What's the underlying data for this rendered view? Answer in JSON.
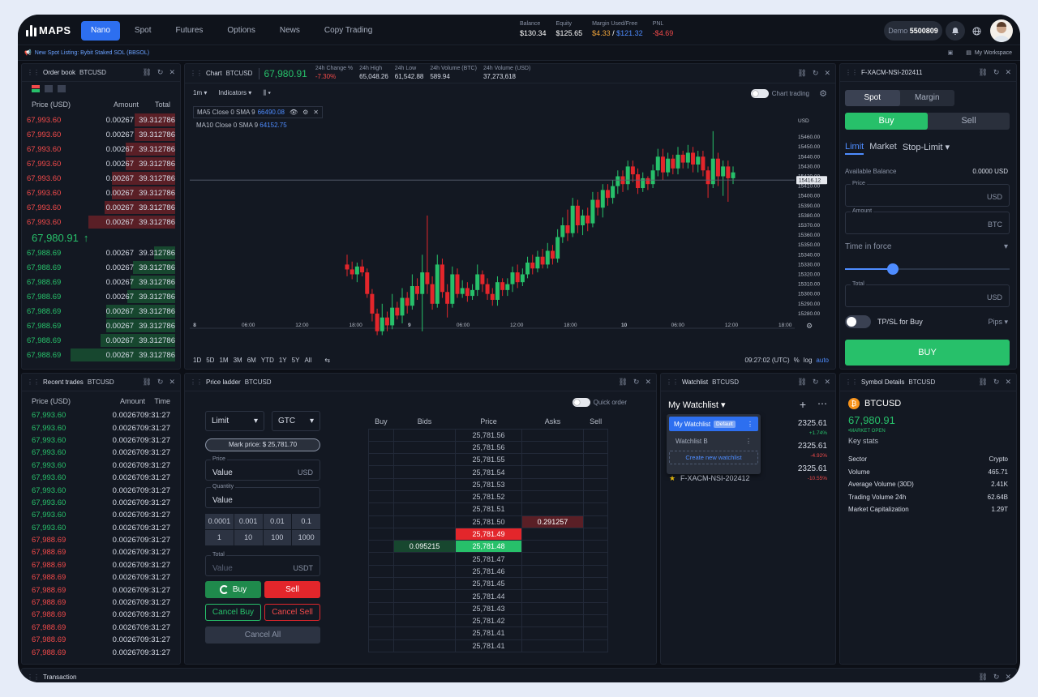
{
  "app": {
    "logo": "MAPS"
  },
  "nav": [
    "Nano",
    "Spot",
    "Futures",
    "Options",
    "News",
    "Copy Trading"
  ],
  "account": {
    "balance_label": "Balance",
    "balance": "$130.34",
    "equity_label": "Equity",
    "equity": "$125.65",
    "margin_label": "Margin Used/Free",
    "margin_used": "$4.33",
    "margin_sep": " / ",
    "margin_free": "$121.32",
    "pnl_label": "PNL",
    "pnl": "-$4.69",
    "demo_label": "Demo",
    "demo_id": "5500809"
  },
  "announcement": "New Spot Listing: Bybit Staked SOL (BBSOL)",
  "workspace": "My Workspace",
  "orderbook": {
    "title": "Order book",
    "symbol": "BTCUSD",
    "headers": [
      "Price (USD)",
      "Amount",
      "Total"
    ],
    "asks": [
      {
        "p": "67,993.60",
        "a": "0.00267",
        "t": "39.312786",
        "d": 0.27
      },
      {
        "p": "67,993.60",
        "a": "0.00267",
        "t": "39.312786",
        "d": 0.27
      },
      {
        "p": "67,993.60",
        "a": "0.00267",
        "t": "39.312786",
        "d": 0.33
      },
      {
        "p": "67,993.60",
        "a": "0.00267",
        "t": "39.312786",
        "d": 0.33
      },
      {
        "p": "67,993.60",
        "a": "0.00267",
        "t": "39.312786",
        "d": 0.42
      },
      {
        "p": "67,993.60",
        "a": "0.00267",
        "t": "39.312786",
        "d": 0.42
      },
      {
        "p": "67,993.60",
        "a": "0.00267",
        "t": "39.312786",
        "d": 0.47
      },
      {
        "p": "67,993.60",
        "a": "0.00267",
        "t": "39.312786",
        "d": 0.58
      }
    ],
    "last": "67,980.91",
    "bids": [
      {
        "p": "67,988.69",
        "a": "0.00267",
        "t": "39.312786",
        "d": 0.14
      },
      {
        "p": "67,988.69",
        "a": "0.00267",
        "t": "39.312786",
        "d": 0.28
      },
      {
        "p": "67,988.69",
        "a": "0.00267",
        "t": "39.312786",
        "d": 0.3
      },
      {
        "p": "67,988.69",
        "a": "0.00267",
        "t": "39.312786",
        "d": 0.32
      },
      {
        "p": "67,988.69",
        "a": "0.00267",
        "t": "39.312786",
        "d": 0.46
      },
      {
        "p": "67,988.69",
        "a": "0.00267",
        "t": "39.312786",
        "d": 0.46
      },
      {
        "p": "67,988.69",
        "a": "0.00267",
        "t": "39.312786",
        "d": 0.5
      },
      {
        "p": "67,988.69",
        "a": "0.00267",
        "t": "39.312786",
        "d": 0.7
      }
    ]
  },
  "chart": {
    "title": "Chart",
    "symbol": "BTCUSD",
    "price": "67,980.91",
    "change_label": "24h Change %",
    "change": "-7.30%",
    "high_label": "24h High",
    "high": "65,048.26",
    "low_label": "24h Low",
    "low": "61,542.88",
    "vol_btc_label": "24h Volume (BTC)",
    "vol_btc": "589.94",
    "vol_usd_label": "24h Volume (USD)",
    "vol_usd": "37,273,618",
    "interval": "1m",
    "indicators": "Indicators",
    "chart_trading": "Chart trading",
    "ma5_label": "MA5 Close 0 SMA 9",
    "ma5_value": "66490.08",
    "ma10_label": "MA10 Close 0 SMA 9",
    "ma10_value": "64152.75",
    "currency": "USD",
    "price_ticks": [
      "15460.00",
      "15450.00",
      "15440.00",
      "15430.00",
      "15420.00",
      "15410.00",
      "15400.00",
      "15390.00",
      "15380.00",
      "15370.00",
      "15360.00",
      "15350.00",
      "15340.00",
      "15330.00",
      "15320.00",
      "15310.00",
      "15300.00",
      "15290.00",
      "15280.00"
    ],
    "current_marker": "15416.12",
    "time_ticks": [
      "8",
      "06:00",
      "12:00",
      "18:00",
      "9",
      "06:00",
      "12:00",
      "18:00",
      "10",
      "06:00",
      "12:00",
      "18:00"
    ],
    "timeframes": [
      "1D",
      "5D",
      "1M",
      "3M",
      "6M",
      "YTD",
      "1Y",
      "5Y",
      "All"
    ],
    "clock": "09:27:02 (UTC)",
    "pct": "%",
    "log": "log",
    "auto": "auto"
  },
  "chart_data": {
    "type": "candlestick",
    "y_range": [
      15270,
      15470
    ],
    "candles": [
      [
        15330,
        15325,
        15340,
        15318
      ],
      [
        15325,
        15320,
        15333,
        15315
      ],
      [
        15320,
        15328,
        15332,
        15312
      ],
      [
        15328,
        15322,
        15335,
        15318
      ],
      [
        15322,
        15300,
        15326,
        15296
      ],
      [
        15300,
        15280,
        15305,
        15272
      ],
      [
        15280,
        15262,
        15285,
        15258
      ],
      [
        15262,
        15276,
        15290,
        15258
      ],
      [
        15276,
        15268,
        15282,
        15262
      ],
      [
        15268,
        15286,
        15300,
        15264
      ],
      [
        15286,
        15278,
        15292,
        15274
      ],
      [
        15278,
        15296,
        15306,
        15270
      ],
      [
        15296,
        15288,
        15302,
        15280
      ],
      [
        15288,
        15308,
        15320,
        15284
      ],
      [
        15308,
        15300,
        15316,
        15294
      ],
      [
        15300,
        15322,
        15340,
        15262
      ],
      [
        15322,
        15310,
        15380,
        15300
      ],
      [
        15310,
        15290,
        15318,
        15284
      ],
      [
        15290,
        15330,
        15340,
        15286
      ],
      [
        15330,
        15302,
        15336,
        15296
      ],
      [
        15302,
        15290,
        15310,
        15276
      ],
      [
        15290,
        15320,
        15328,
        15286
      ],
      [
        15320,
        15300,
        15326,
        15296
      ],
      [
        15300,
        15306,
        15314,
        15296
      ],
      [
        15306,
        15298,
        15312,
        15292
      ],
      [
        15298,
        15304,
        15310,
        15294
      ],
      [
        15304,
        15320,
        15330,
        15298
      ],
      [
        15320,
        15310,
        15324,
        15302
      ],
      [
        15310,
        15300,
        15316,
        15294
      ],
      [
        15300,
        15294,
        15306,
        15288
      ],
      [
        15294,
        15312,
        15318,
        15288
      ],
      [
        15312,
        15304,
        15316,
        15298
      ],
      [
        15304,
        15310,
        15316,
        15298
      ],
      [
        15310,
        15322,
        15328,
        15302
      ],
      [
        15322,
        15312,
        15330,
        15306
      ],
      [
        15312,
        15320,
        15326,
        15308
      ],
      [
        15320,
        15332,
        15338,
        15316
      ],
      [
        15332,
        15326,
        15340,
        15320
      ],
      [
        15326,
        15338,
        15344,
        15322
      ],
      [
        15338,
        15330,
        15346,
        15326
      ],
      [
        15330,
        15344,
        15352,
        15326
      ],
      [
        15344,
        15336,
        15350,
        15330
      ],
      [
        15336,
        15358,
        15366,
        15332
      ],
      [
        15358,
        15370,
        15378,
        15352
      ],
      [
        15370,
        15362,
        15386,
        15354
      ],
      [
        15362,
        15390,
        15398,
        15358
      ],
      [
        15390,
        15370,
        15396,
        15362
      ],
      [
        15370,
        15380,
        15386,
        15360
      ],
      [
        15380,
        15372,
        15388,
        15364
      ],
      [
        15372,
        15396,
        15404,
        15368
      ],
      [
        15396,
        15388,
        15404,
        15380
      ],
      [
        15388,
        15406,
        15412,
        15378
      ],
      [
        15406,
        15398,
        15412,
        15390
      ],
      [
        15398,
        15410,
        15416,
        15392
      ],
      [
        15410,
        15420,
        15426,
        15402
      ],
      [
        15420,
        15412,
        15426,
        15404
      ],
      [
        15412,
        15430,
        15436,
        15406
      ],
      [
        15430,
        15422,
        15436,
        15414
      ],
      [
        15422,
        15408,
        15428,
        15402
      ],
      [
        15408,
        15418,
        15424,
        15404
      ],
      [
        15418,
        15412,
        15420,
        15406
      ],
      [
        15412,
        15426,
        15432,
        15408
      ],
      [
        15426,
        15440,
        15448,
        15420
      ],
      [
        15440,
        15424,
        15448,
        15416
      ],
      [
        15424,
        15438,
        15444,
        15420
      ],
      [
        15438,
        15428,
        15442,
        15422
      ],
      [
        15428,
        15442,
        15450,
        15422
      ],
      [
        15442,
        15434,
        15446,
        15428
      ],
      [
        15434,
        15444,
        15452,
        15428
      ],
      [
        15444,
        15432,
        15450,
        15424
      ],
      [
        15432,
        15440,
        15446,
        15424
      ],
      [
        15440,
        15426,
        15446,
        15420
      ],
      [
        15426,
        15412,
        15430,
        15398
      ],
      [
        15412,
        15438,
        15466,
        15408
      ],
      [
        15438,
        15420,
        15444,
        15410
      ],
      [
        15420,
        15430,
        15436,
        15400
      ],
      [
        15430,
        15418,
        15436,
        15394
      ],
      [
        15418,
        15424,
        15430,
        15412
      ]
    ]
  },
  "order_form": {
    "title": "F-XACM-NSI-202411",
    "tabs": [
      "Spot",
      "Margin"
    ],
    "buy": "Buy",
    "sell": "Sell",
    "types": [
      "Limit",
      "Market",
      "Stop-Limit"
    ],
    "available_label": "Available Balance",
    "available": "0.0000 USD",
    "price_label": "Price",
    "price_unit": "USD",
    "amount_label": "Amount",
    "amount_unit": "BTC",
    "tif": "Time in force",
    "slider_value": 0.29,
    "total_label": "Total",
    "total_unit": "USD",
    "tpsl": "TP/SL for Buy",
    "pips": "Pips",
    "submit": "BUY"
  },
  "trades": {
    "title": "Recent trades",
    "symbol": "BTCUSD",
    "headers": [
      "Price (USD)",
      "Amount",
      "Time"
    ],
    "rows": [
      {
        "p": "67,993.60",
        "a": "0.00267",
        "t": "09:31:27",
        "s": "buy"
      },
      {
        "p": "67,993.60",
        "a": "0.00267",
        "t": "09:31:27",
        "s": "buy"
      },
      {
        "p": "67,993.60",
        "a": "0.00267",
        "t": "09:31:27",
        "s": "buy"
      },
      {
        "p": "67,993.60",
        "a": "0.00267",
        "t": "09:31:27",
        "s": "buy"
      },
      {
        "p": "67,993.60",
        "a": "0.00267",
        "t": "09:31:27",
        "s": "buy"
      },
      {
        "p": "67,993.60",
        "a": "0.00267",
        "t": "09:31:27",
        "s": "buy"
      },
      {
        "p": "67,993.60",
        "a": "0.00267",
        "t": "09:31:27",
        "s": "buy"
      },
      {
        "p": "67,993.60",
        "a": "0.00267",
        "t": "09:31:27",
        "s": "buy"
      },
      {
        "p": "67,993.60",
        "a": "0.00267",
        "t": "09:31:27",
        "s": "buy"
      },
      {
        "p": "67,993.60",
        "a": "0.00267",
        "t": "09:31:27",
        "s": "buy"
      },
      {
        "p": "67,988.69",
        "a": "0.00267",
        "t": "09:31:27",
        "s": "sell"
      },
      {
        "p": "67,988.69",
        "a": "0.00267",
        "t": "09:31:27",
        "s": "sell"
      },
      {
        "p": "67,988.69",
        "a": "0.00267",
        "t": "09:31:27",
        "s": "sell"
      },
      {
        "p": "67,988.69",
        "a": "0.00267",
        "t": "09:31:27",
        "s": "sell"
      },
      {
        "p": "67,988.69",
        "a": "0.00267",
        "t": "09:31:27",
        "s": "sell"
      },
      {
        "p": "67,988.69",
        "a": "0.00267",
        "t": "09:31:27",
        "s": "sell"
      },
      {
        "p": "67,988.69",
        "a": "0.00267",
        "t": "09:31:27",
        "s": "sell"
      },
      {
        "p": "67,988.69",
        "a": "0.00267",
        "t": "09:31:27",
        "s": "sell"
      },
      {
        "p": "67,988.69",
        "a": "0.00267",
        "t": "09:31:27",
        "s": "sell"
      },
      {
        "p": "67,988.69",
        "a": "0.00267",
        "t": "09:31:27",
        "s": "sell"
      }
    ]
  },
  "ladder": {
    "title": "Price ladder",
    "symbol": "BTCUSD",
    "order_type": "Limit",
    "tif": "GTC",
    "quick_order": "Quick order",
    "mark_price": "Mark price: $ 25,781.70",
    "price_label": "Price",
    "price_value": "Value",
    "price_unit": "USD",
    "qty_label": "Quantity",
    "qty_value": "Value",
    "steps": [
      "0.0001",
      "0.001",
      "0.01",
      "0.1",
      "1",
      "10",
      "100",
      "1000"
    ],
    "total_label": "Total",
    "total_placeholder": "Value",
    "total_unit": "USDT",
    "buy": "Buy",
    "sell": "Sell",
    "cancel_buy": "Cancel Buy",
    "cancel_sell": "Cancel Sell",
    "cancel_all": "Cancel All",
    "headers": [
      "Buy",
      "Bids",
      "Price",
      "Asks",
      "Sell"
    ],
    "rows": [
      {
        "price": "25,781.56",
        "ask": "",
        "bid": ""
      },
      {
        "price": "25,781.56",
        "ask": "",
        "bid": ""
      },
      {
        "price": "25,781.55",
        "ask": "",
        "bid": ""
      },
      {
        "price": "25,781.54",
        "ask": "",
        "bid": ""
      },
      {
        "price": "25,781.53",
        "ask": "",
        "bid": ""
      },
      {
        "price": "25,781.52",
        "ask": "",
        "bid": ""
      },
      {
        "price": "25,781.51",
        "ask": "",
        "bid": ""
      },
      {
        "price": "25,781.50",
        "ask": "0.291257",
        "bid": ""
      },
      {
        "price": "25,781.49",
        "ask": "",
        "bid": "",
        "hl": "ask"
      },
      {
        "price": "25,781.48",
        "ask": "",
        "bid": "0.095215",
        "hl": "bid"
      },
      {
        "price": "25,781.47",
        "ask": "",
        "bid": ""
      },
      {
        "price": "25,781.46",
        "ask": "",
        "bid": ""
      },
      {
        "price": "25,781.45",
        "ask": "",
        "bid": ""
      },
      {
        "price": "25,781.44",
        "ask": "",
        "bid": ""
      },
      {
        "price": "25,781.43",
        "ask": "",
        "bid": ""
      },
      {
        "price": "25,781.42",
        "ask": "",
        "bid": ""
      },
      {
        "price": "25,781.41",
        "ask": "",
        "bid": ""
      },
      {
        "price": "25,781.41",
        "ask": "",
        "bid": ""
      }
    ]
  },
  "watchlist": {
    "title": "Watchlist",
    "symbol": "BTCUSD",
    "name": "My Watchlist",
    "menu": {
      "item1": "My Watchlist",
      "badge": "Default",
      "item2": "Watchlist B",
      "create": "Create new watchlist"
    },
    "rows": [
      {
        "price": "2325.61",
        "chg": "+1.74%",
        "dir": "up"
      },
      {
        "price": "2325.61",
        "chg": "-4.92%",
        "dir": "down"
      },
      {
        "name": "F-XACM-NSI-202412",
        "price": "2325.61",
        "chg": "-10.55%",
        "dir": "down"
      }
    ]
  },
  "details": {
    "title": "Symbol Details",
    "symbol": "BTCUSD",
    "name": "BTCUSD",
    "price": "67,980.91",
    "status": "•MARKET OPEN",
    "key_stats": "Key stats",
    "stats": [
      {
        "k": "Sector",
        "v": "Crypto"
      },
      {
        "k": "Volume",
        "v": "465.71"
      },
      {
        "k": "Average Volume (30D)",
        "v": "2.41K"
      },
      {
        "k": "Trading Volume 24h",
        "v": "62.64B"
      },
      {
        "k": "Market Capitalization",
        "v": "1.29T"
      }
    ]
  },
  "bottom": {
    "title": "Transaction"
  }
}
